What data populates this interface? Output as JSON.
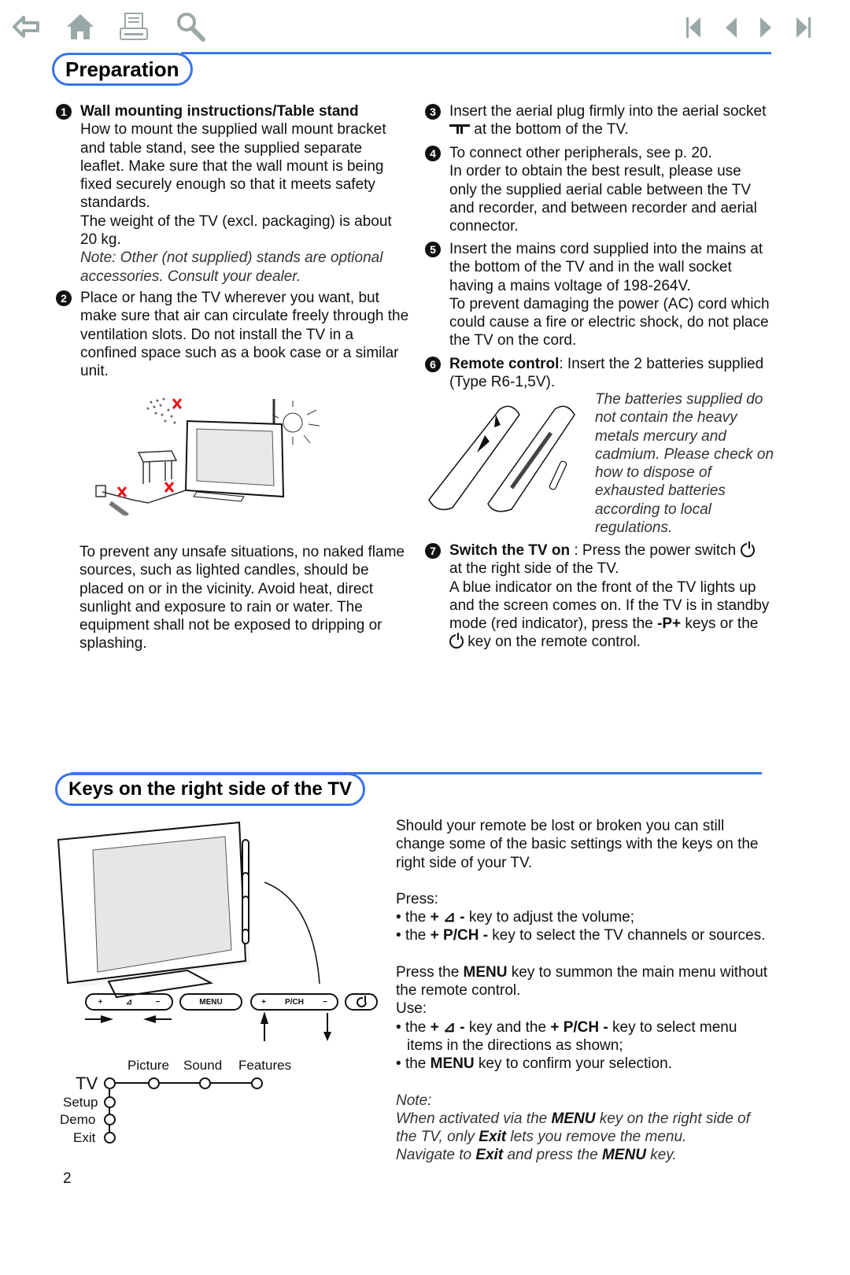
{
  "nav": {
    "left_icons": [
      "back-arrow-icon",
      "home-icon",
      "print-icon",
      "search-icon"
    ],
    "right_icons": [
      "first-page-icon",
      "previous-page-icon",
      "next-page-icon",
      "last-page-icon"
    ],
    "icon_color": "#9aa8a8"
  },
  "accent_color": "#3a74e8",
  "preparation": {
    "title": "Preparation",
    "steps": [
      {
        "num": "1",
        "heading": "Wall mounting instructions/Table stand",
        "text": "How to mount the supplied wall mount bracket and table stand, see the supplied separate leaflet. Make sure that the wall mount is being fixed securely enough so that it meets safety standards.",
        "text2": "The weight of the TV (excl. packaging) is about 20 kg.",
        "note": "Note: Other (not supplied) stands are optional accessories. Consult your dealer."
      },
      {
        "num": "2",
        "text": "Place or hang the TV wherever you want, but make sure that air can circulate freely through the ventilation slots. Do not install the TV in a confined space such as a book case or a similar unit."
      },
      {
        "num": "3",
        "text_a": "Insert the aerial plug firmly into the aerial socket",
        "text_b": "at the bottom of the TV."
      },
      {
        "num": "4",
        "text": "To connect other peripherals, see p. 20.",
        "text2": "In order to obtain the best result, please use only the supplied aerial cable between the TV and recorder, and between recorder and aerial connector."
      },
      {
        "num": "5",
        "text": "Insert the mains cord supplied into the mains at the bottom of the TV and in the wall socket having a mains voltage of 198-264V.",
        "text2": "To prevent damaging the power (AC) cord which could cause a fire or electric shock, do not place the TV on the cord."
      },
      {
        "num": "6",
        "heading": "Remote control",
        "text": ": Insert the 2 batteries supplied (Type R6-1,5V).",
        "note": "The batteries supplied do not contain the heavy metals mercury and cadmium. Please check on how to dispose of exhausted batteries according to local regulations."
      },
      {
        "num": "7",
        "heading": "Switch the TV on",
        "text_a": " : Press the power switch",
        "text_b": "at the right side of the TV.",
        "text2_a": "A blue indicator on the front of the TV lights up and the screen comes on. If the TV is in standby mode (red indicator), press the",
        "text2_key": "-P+",
        "text2_b": "keys or the",
        "text2_c": "key on the remote control."
      }
    ],
    "safety_text": "To prevent any unsafe situations, no naked flame sources, such as lighted candles, should be placed on or in the vicinity. Avoid heat, direct sunlight and exposure to rain or water. The equipment shall not be exposed to dripping or splashing."
  },
  "keys": {
    "title": "Keys on the right side of the TV",
    "intro": "Should your remote be lost or broken you can still change some of the basic settings with the keys on the right side of your TV.",
    "press_label": "Press:",
    "bullets1": [
      {
        "pre": "the ",
        "key": "+ ⊿ -",
        "post": " key to adjust the volume;"
      },
      {
        "pre": "the ",
        "key": "+ P/CH -",
        "post": " key to select the TV channels or sources."
      }
    ],
    "menu_a": "Press the ",
    "menu_key": "MENU",
    "menu_b": " key to summon the main menu without the remote control.",
    "use_label": "Use:",
    "bullets2": [
      {
        "pre": "the ",
        "key": "+ ⊿ -",
        "mid": " key and the ",
        "key2": "+ P/CH -",
        "post": " key to select menu items in the directions as shown;"
      },
      {
        "pre": "the ",
        "key": "MENU",
        "post": " key to confirm your selection."
      }
    ],
    "note_label": "Note:",
    "note_a": "When activated via the ",
    "note_menu": "MENU",
    "note_b": " key on the right side of the TV, only ",
    "note_exit": "Exit",
    "note_c": " lets you remove the menu.",
    "note_d": "Navigate to ",
    "note_exit2": "Exit",
    "note_e": " and press the ",
    "note_menu2": "MENU",
    "note_f": " key.",
    "keybar": {
      "vol_plus": "+",
      "vol_icon": "⊿",
      "vol_minus": "−",
      "menu": "MENU",
      "ch_plus": "+",
      "ch_label": "P/CH",
      "ch_minus": "−"
    },
    "menu_diagram": {
      "root": "TV",
      "horizontal": [
        "Picture",
        "Sound",
        "Features"
      ],
      "vertical": [
        "Setup",
        "Demo",
        "Exit"
      ]
    }
  },
  "page_number": "2"
}
